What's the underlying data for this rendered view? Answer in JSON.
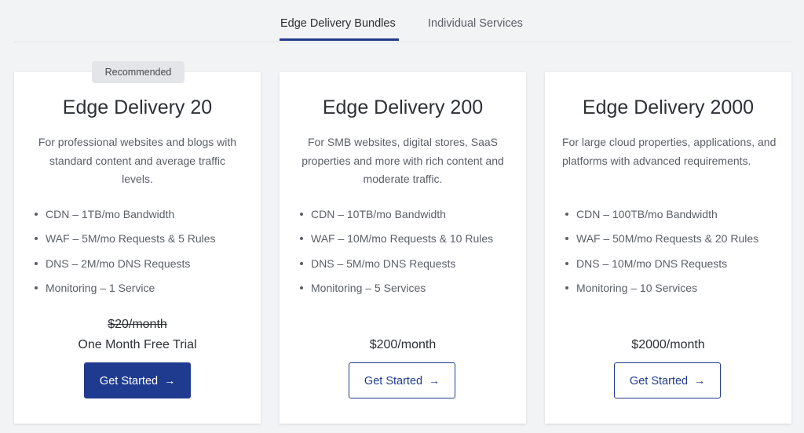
{
  "tabs": [
    {
      "label": "Edge Delivery Bundles",
      "active": true
    },
    {
      "label": "Individual Services",
      "active": false
    }
  ],
  "accent_color": "#1f3b8f",
  "plans": [
    {
      "badge": "Recommended",
      "title": "Edge Delivery 20",
      "description": "For professional websites and blogs with standard content and average traffic levels.",
      "features": [
        "CDN – 1TB/mo Bandwidth",
        "WAF – 5M/mo Requests & 5 Rules",
        "DNS – 2M/mo DNS Requests",
        "Monitoring – 1 Service"
      ],
      "old_price": "$20/month",
      "price": "One Month Free Trial",
      "button_label": "Get Started",
      "button_icon": "arrow-right-icon"
    },
    {
      "title": "Edge Delivery 200",
      "description": "For SMB websites, digital stores, SaaS properties and more with rich content and moderate traffic.",
      "features": [
        "CDN – 10TB/mo Bandwidth",
        "WAF – 10M/mo Requests & 10 Rules",
        "DNS – 5M/mo DNS Requests",
        "Monitoring – 5 Services"
      ],
      "price": "$200/month",
      "button_label": "Get Started",
      "button_icon": "arrow-right-icon"
    },
    {
      "title": "Edge Delivery 2000",
      "description": "For large cloud properties, applications, and platforms with advanced requirements.",
      "features": [
        "CDN – 100TB/mo Bandwidth",
        "WAF – 50M/mo Requests & 20 Rules",
        "DNS – 10M/mo DNS Requests",
        "Monitoring – 10 Services"
      ],
      "price": "$2000/month",
      "button_label": "Get Started",
      "button_icon": "arrow-right-icon"
    }
  ]
}
